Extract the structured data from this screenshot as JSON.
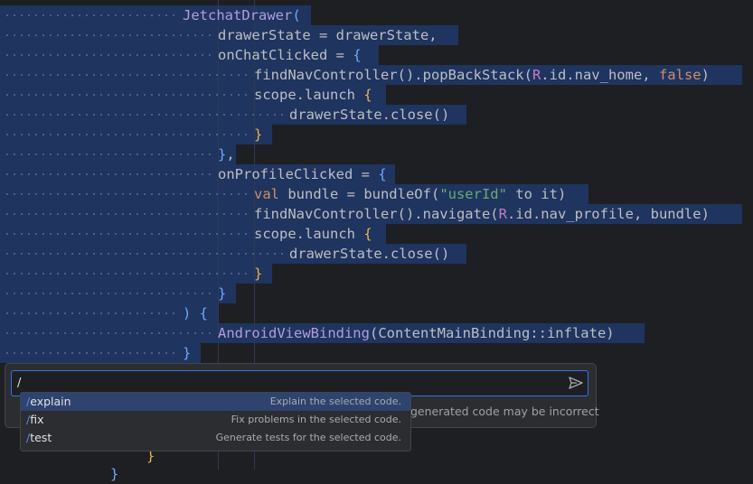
{
  "code_lines": [
    {
      "tokens": [
        {
          "t": "JetchatDrawer",
          "c": "fn"
        },
        {
          "t": "(",
          "c": "p1"
        }
      ]
    },
    {
      "tokens": [
        {
          "t": "drawerState = drawerState,",
          "c": "call"
        }
      ]
    },
    {
      "tokens": [
        {
          "t": "onChatClicked = ",
          "c": "call"
        },
        {
          "t": "{",
          "c": "p1"
        }
      ]
    },
    {
      "tokens": [
        {
          "t": "findNavController().popBackStack(",
          "c": "call"
        },
        {
          "t": "R",
          "c": "r"
        },
        {
          "t": ".id.nav_home, ",
          "c": "call"
        },
        {
          "t": "false",
          "c": "kw"
        },
        {
          "t": ")",
          "c": "call"
        }
      ]
    },
    {
      "tokens": [
        {
          "t": "scope.launch ",
          "c": "call"
        },
        {
          "t": "{",
          "c": "p2"
        }
      ]
    },
    {
      "tokens": [
        {
          "t": "drawerState.close()",
          "c": "call"
        }
      ]
    },
    {
      "tokens": [
        {
          "t": "}",
          "c": "p2"
        }
      ]
    },
    {
      "tokens": [
        {
          "t": "}",
          "c": "p1"
        },
        {
          "t": ",",
          "c": "call"
        }
      ]
    },
    {
      "tokens": [
        {
          "t": "onProfileClicked = ",
          "c": "call"
        },
        {
          "t": "{",
          "c": "p1"
        }
      ]
    },
    {
      "tokens": [
        {
          "t": "val ",
          "c": "kw"
        },
        {
          "t": "bundle = bundleOf(",
          "c": "call"
        },
        {
          "t": "\"userId\"",
          "c": "str"
        },
        {
          "t": " to it)",
          "c": "call"
        }
      ]
    },
    {
      "tokens": [
        {
          "t": "findNavController().navigate(",
          "c": "call"
        },
        {
          "t": "R",
          "c": "r"
        },
        {
          "t": ".id.nav_profile, bundle)",
          "c": "call"
        }
      ]
    },
    {
      "tokens": [
        {
          "t": "scope.launch ",
          "c": "call"
        },
        {
          "t": "{",
          "c": "p2"
        }
      ]
    },
    {
      "tokens": [
        {
          "t": "drawerState.close()",
          "c": "call"
        }
      ]
    },
    {
      "tokens": [
        {
          "t": "}",
          "c": "p2"
        }
      ]
    },
    {
      "tokens": [
        {
          "t": "}",
          "c": "p1"
        }
      ]
    },
    {
      "tokens": [
        {
          "t": ") ",
          "c": "p1"
        },
        {
          "t": "{",
          "c": "p1"
        }
      ]
    },
    {
      "tokens": [
        {
          "t": "AndroidViewBinding",
          "c": "fn"
        },
        {
          "t": "(ContentMainBinding::inflate)",
          "c": "call"
        }
      ]
    },
    {
      "tokens": [
        {
          "t": "}",
          "c": "p1"
        }
      ]
    }
  ],
  "ai_prompt": {
    "input_value": "/",
    "disclaimer": "generated code may be incorrect",
    "send_icon": "send-icon"
  },
  "suggestions": [
    {
      "command": "explain",
      "description": "Explain the selected code."
    },
    {
      "command": "fix",
      "description": "Fix problems in the selected code."
    },
    {
      "command": "test",
      "description": "Generate tests for the selected code."
    }
  ],
  "trailing": {
    "brace_a": "}",
    "brace_b": "}"
  }
}
